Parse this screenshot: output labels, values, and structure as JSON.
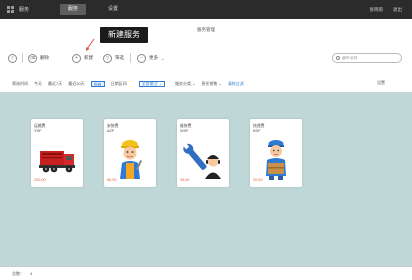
{
  "topbar": {
    "app_title": "服务",
    "tabs": [
      {
        "label": "服务",
        "active": true
      },
      {
        "label": "设置",
        "active": false
      }
    ],
    "right": {
      "user": "张晓雨",
      "logout": "退出"
    }
  },
  "page_title": "服务管理",
  "callout": "新建服务",
  "toolbar": {
    "delete_label": "删除",
    "new_label": "新建",
    "filter_label": "筛选",
    "more_label": "更多"
  },
  "search": {
    "placeholder": "编号/名称"
  },
  "filters": {
    "time_label": "筛选时间",
    "today": "今天",
    "last7": "最近7天",
    "last30": "最近30天",
    "all": "所有",
    "date_range": "日期区间",
    "all_status": "全部激活",
    "category": "服务分类",
    "person": "责任销售",
    "clear": "清除过滤",
    "settings": "设置"
  },
  "cards": [
    {
      "name": "运输费",
      "code": "YSF",
      "price": "200.00",
      "icon": "truck-icon"
    },
    {
      "name": "安装费",
      "code": "AZF",
      "price": "50.00",
      "icon": "worker-icon"
    },
    {
      "name": "维修费",
      "code": "WXF",
      "price": "25.00",
      "icon": "repair-icon"
    },
    {
      "name": "快递费",
      "code": "KDF",
      "price": "20.00",
      "icon": "courier-icon"
    }
  ],
  "footer": {
    "total_label": "总数：",
    "total": "4"
  },
  "colors": {
    "topbar": "#2b2b2b",
    "content_bg": "#bfd7d7",
    "accent": "#2f7bd1",
    "price": "#e0583a"
  }
}
